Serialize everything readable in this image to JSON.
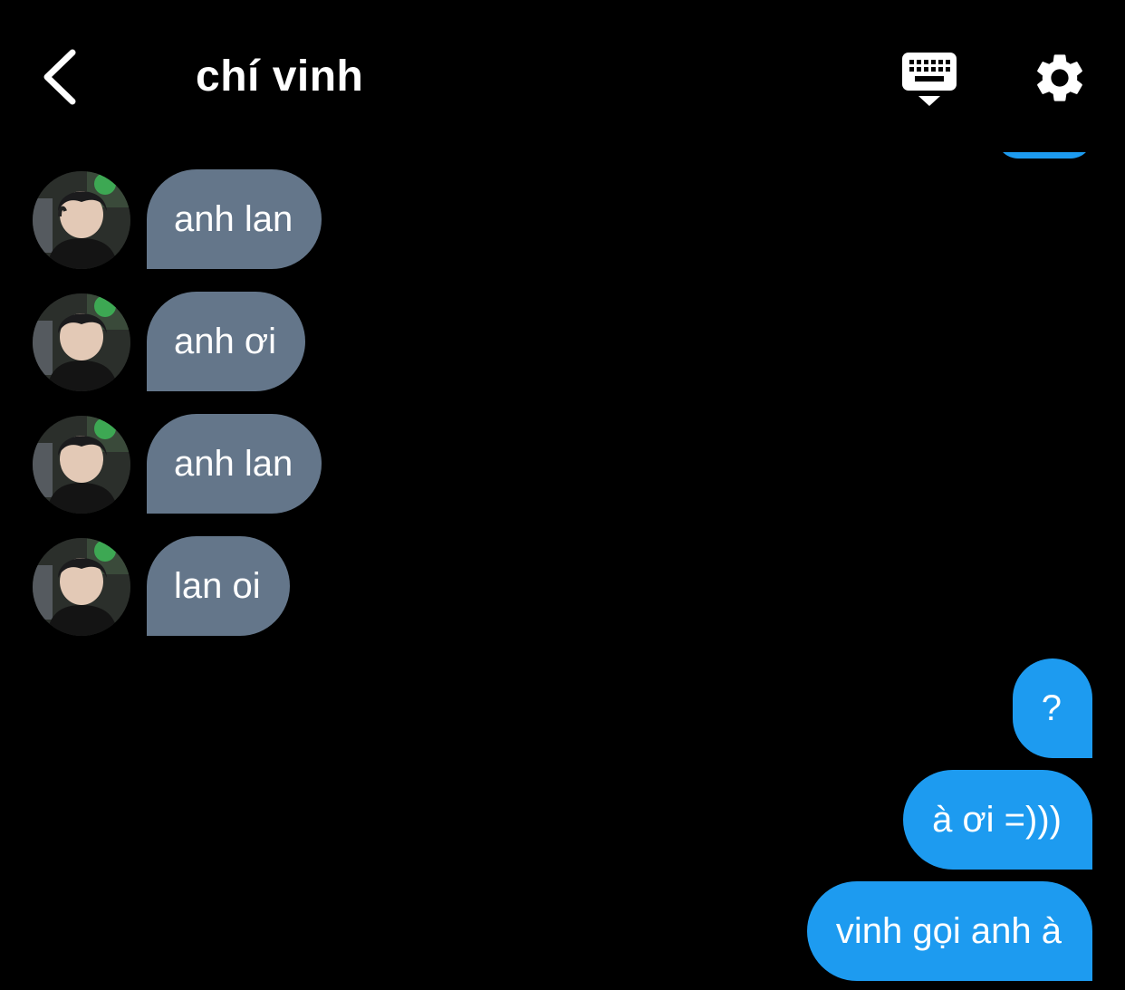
{
  "header": {
    "title": "chí vinh",
    "back_icon": "chevron-left-icon",
    "keyboard_icon": "keyboard-hide-icon",
    "settings_icon": "gear-icon"
  },
  "colors": {
    "background": "#000000",
    "incoming_bubble": "#64768a",
    "outgoing_bubble": "#1d9bf0",
    "text": "#ffffff"
  },
  "messages": [
    {
      "direction": "incoming",
      "text": "anh lan"
    },
    {
      "direction": "incoming",
      "text": "anh ơi"
    },
    {
      "direction": "incoming",
      "text": "anh lan"
    },
    {
      "direction": "incoming",
      "text": "lan oi"
    },
    {
      "direction": "outgoing",
      "text": "?"
    },
    {
      "direction": "outgoing",
      "text": "à ơi =)))"
    },
    {
      "direction": "outgoing",
      "text": "vinh gọi anh à"
    }
  ]
}
